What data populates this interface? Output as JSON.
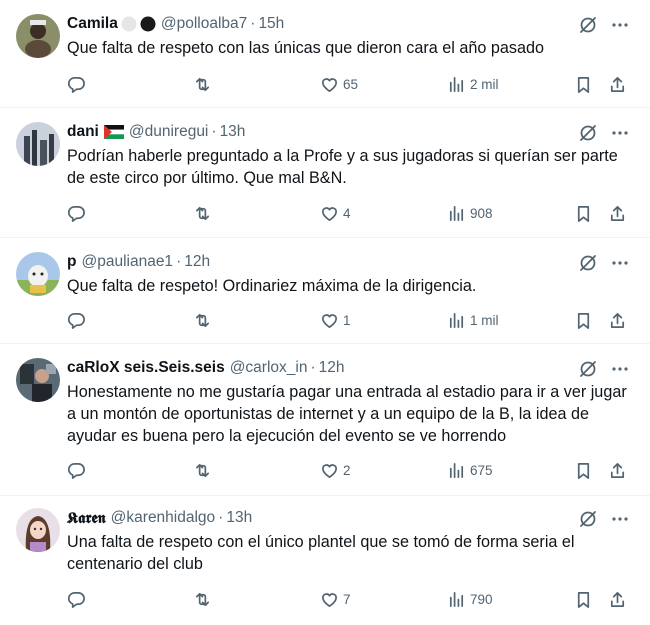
{
  "tweets": [
    {
      "name": "Camila",
      "handle": "@polloalba7",
      "time": "15h",
      "text": "Que falta de respeto con  las únicas que dieron cara el año pasado",
      "replies": "",
      "retweets": "",
      "likes": "65",
      "views": "2 mil"
    },
    {
      "name": "dani",
      "handle": "@duniregui",
      "time": "13h",
      "text": "Podrían haberle preguntado a la Profe y a sus jugadoras si querían ser parte de este circo por último. Que mal B&N.",
      "replies": "",
      "retweets": "",
      "likes": "4",
      "views": "908"
    },
    {
      "name": "p",
      "handle": "@paulianae1",
      "time": "12h",
      "text": "Que falta de respeto! Ordinariez máxima de la dirigencia.",
      "replies": "",
      "retweets": "",
      "likes": "1",
      "views": "1 mil"
    },
    {
      "name": "caRloX seis.Seis.seis",
      "handle": "@carlox_in",
      "time": "12h",
      "text": "Honestamente no me gustaría pagar una entrada al estadio para ir a ver jugar a un montón de oportunistas de internet y a un equipo de la B, la idea de ayudar es buena pero la ejecución del evento se ve horrendo",
      "replies": "",
      "retweets": "",
      "likes": "2",
      "views": "675"
    },
    {
      "name": "𝕶𝖆𝖗𝖊𝖓",
      "handle": "@karenhidalgo",
      "time": "13h",
      "text": "Una falta de respeto con el único plantel que se tomó de forma seria el centenario del club",
      "replies": "",
      "retweets": "",
      "likes": "7",
      "views": "790"
    }
  ],
  "icons": {
    "reply": "reply-icon",
    "retweet": "retweet-icon",
    "like": "heart-icon",
    "views": "views-icon",
    "bookmark": "bookmark-icon",
    "share": "share-icon",
    "grok": "grok-icon",
    "more": "more-icon"
  },
  "colors": {
    "text": "#0f1419",
    "secondary": "#536471",
    "divider": "#eff3f4"
  }
}
